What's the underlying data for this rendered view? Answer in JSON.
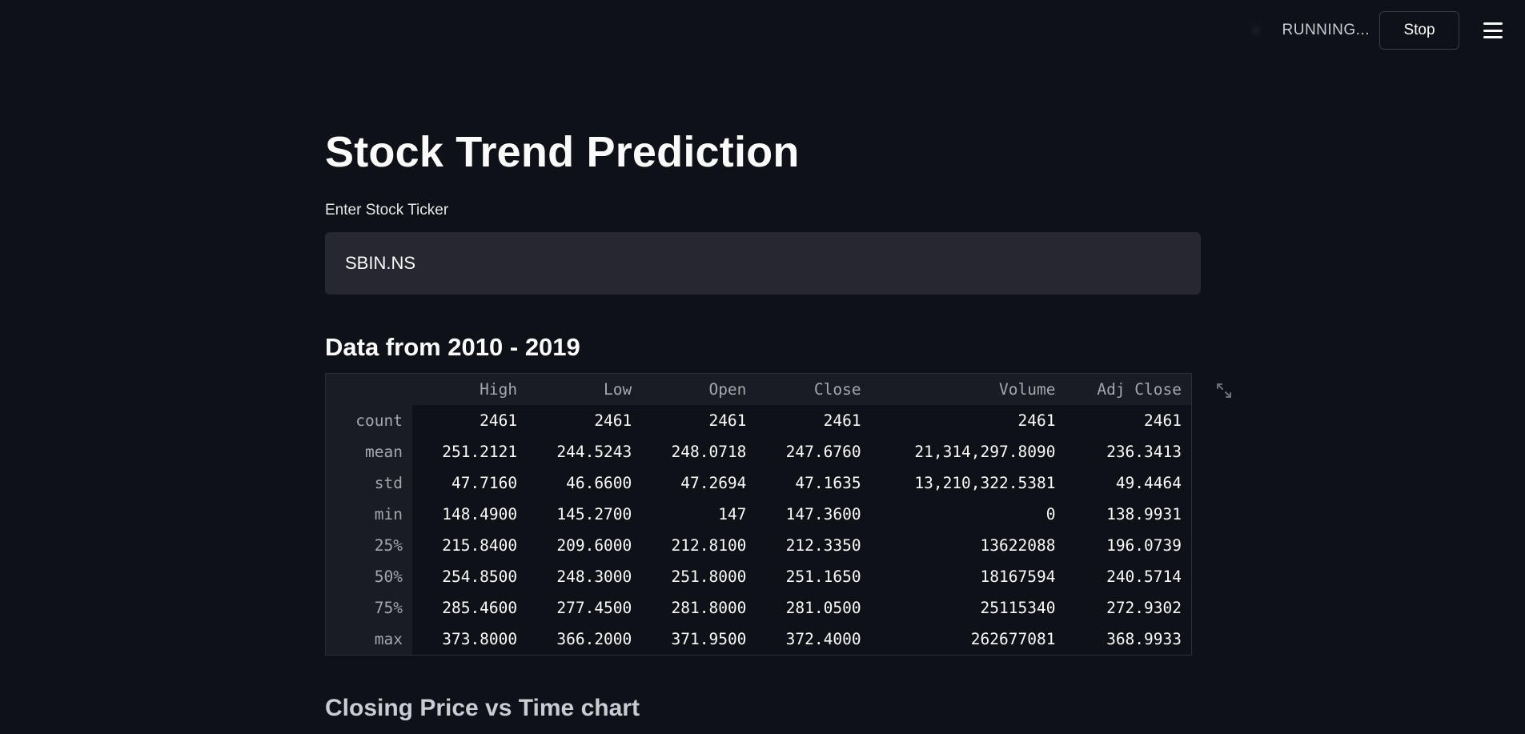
{
  "header": {
    "status_text": "RUNNING...",
    "stop_label": "Stop",
    "running_icon": "running-man-icon",
    "menu_icon": "hamburger-menu-icon"
  },
  "main": {
    "title": "Stock Trend Prediction",
    "ticker_input": {
      "label": "Enter Stock Ticker",
      "value": "SBIN.NS"
    },
    "data_section_title": "Data from 2010 - 2019",
    "table": {
      "columns": [
        "",
        "High",
        "Low",
        "Open",
        "Close",
        "Volume",
        "Adj Close"
      ],
      "rows": [
        {
          "label": "count",
          "values": [
            "2461",
            "2461",
            "2461",
            "2461",
            "2461",
            "2461"
          ]
        },
        {
          "label": "mean",
          "values": [
            "251.2121",
            "244.5243",
            "248.0718",
            "247.6760",
            "21,314,297.8090",
            "236.3413"
          ]
        },
        {
          "label": "std",
          "values": [
            "47.7160",
            "46.6600",
            "47.2694",
            "47.1635",
            "13,210,322.5381",
            "49.4464"
          ]
        },
        {
          "label": "min",
          "values": [
            "148.4900",
            "145.2700",
            "147",
            "147.3600",
            "0",
            "138.9931"
          ]
        },
        {
          "label": "25%",
          "values": [
            "215.8400",
            "209.6000",
            "212.8100",
            "212.3350",
            "13622088",
            "196.0739"
          ]
        },
        {
          "label": "50%",
          "values": [
            "254.8500",
            "248.3000",
            "251.8000",
            "251.1650",
            "18167594",
            "240.5714"
          ]
        },
        {
          "label": "75%",
          "values": [
            "285.4600",
            "277.4500",
            "281.8000",
            "281.0500",
            "25115340",
            "272.9302"
          ]
        },
        {
          "label": "max",
          "values": [
            "373.8000",
            "366.2000",
            "371.9500",
            "372.4000",
            "262677081",
            "368.9933"
          ]
        }
      ]
    },
    "expand_icon": "expand-fullscreen-icon",
    "next_section_title": "Closing Price vs Time chart"
  }
}
